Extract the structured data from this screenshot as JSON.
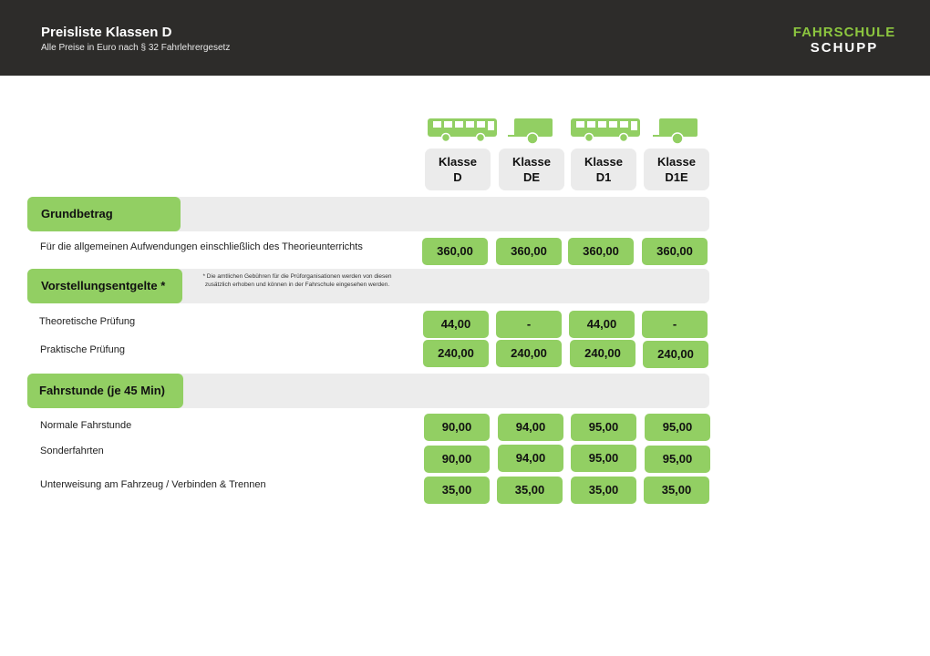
{
  "header": {
    "title": "Preisliste Klassen D",
    "subtitle": "Alle Preise in Euro nach § 32 Fahrlehrergesetz",
    "logo_line1": "FAHRSCHULE",
    "logo_line2": "SCHUPP"
  },
  "colors": {
    "header_bg": "#2d2c2a",
    "accent_green": "#92cf63",
    "band_gray": "#ececec",
    "logo_green": "#8cc63f"
  },
  "columns": [
    {
      "icon": "bus-icon",
      "label_line1": "Klasse",
      "label_line2": "D"
    },
    {
      "icon": "trailer-icon",
      "label_line1": "Klasse",
      "label_line2": "DE"
    },
    {
      "icon": "bus-icon",
      "label_line1": "Klasse",
      "label_line2": "D1"
    },
    {
      "icon": "trailer-icon",
      "label_line1": "Klasse",
      "label_line2": "D1E"
    }
  ],
  "sections": {
    "grundbetrag": {
      "title": "Grundbetrag",
      "rows": [
        {
          "label": "Für die allgemeinen Aufwendungen einschließlich des Theorieunterrichts",
          "values": [
            "360,00",
            "360,00",
            "360,00",
            "360,00"
          ]
        }
      ]
    },
    "vorstellung": {
      "title": "Vorstellungsentgelte *",
      "note": "* Die amtlichen Gebühren für die Prüforganisationen werden von diesen zusätzlich erhoben und können in der Fahrschule eingesehen werden.",
      "rows": [
        {
          "label": "Theoretische Prüfung",
          "values": [
            "44,00",
            "-",
            "44,00",
            "-"
          ]
        },
        {
          "label": "Praktische Prüfung",
          "values": [
            "240,00",
            "240,00",
            "240,00",
            "240,00"
          ]
        }
      ]
    },
    "fahrstunde": {
      "title": "Fahrstunde (je 45 Min)",
      "rows": [
        {
          "label": "Normale Fahrstunde",
          "values": [
            "90,00",
            "94,00",
            "95,00",
            "95,00"
          ]
        },
        {
          "label": "Sonderfahrten",
          "values": [
            "90,00",
            "94,00",
            "95,00",
            "95,00"
          ]
        },
        {
          "label": "Unterweisung am Fahrzeug / Verbinden & Trennen",
          "values": [
            "35,00",
            "35,00",
            "35,00",
            "35,00"
          ]
        }
      ]
    }
  }
}
